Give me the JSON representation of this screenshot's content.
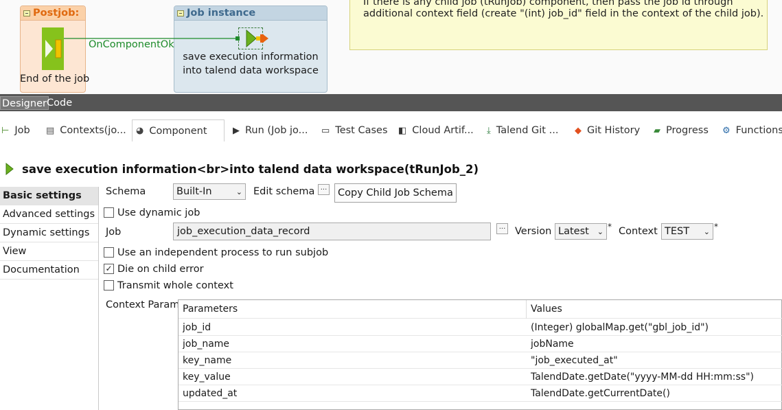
{
  "canvas": {
    "note_lines": [
      "If there is any child job (tRunJob) component, then pass the job id through",
      "additional context field (create \"(int) job_id\" field in the context of the child job)."
    ],
    "postjob_title": "Postjob:",
    "postjob_component_label": "End of the job",
    "link_label": "OnComponentOk",
    "subjob_title": "Job instance",
    "runjob_label_line1": "save execution information",
    "runjob_label_line2": "into talend data workspace"
  },
  "editor_tabs": [
    "Designer",
    "Code"
  ],
  "view_tabs": [
    {
      "label": "Job",
      "icon": "job-icon"
    },
    {
      "label": "Contexts(jo...",
      "icon": "contexts-icon"
    },
    {
      "label": "Component",
      "icon": "component-icon"
    },
    {
      "label": "Run (Job jo...",
      "icon": "run-icon"
    },
    {
      "label": "Test Cases",
      "icon": "test-cases-icon"
    },
    {
      "label": "Cloud Artif...",
      "icon": "cloud-artifact-icon"
    },
    {
      "label": "Talend Git ...",
      "icon": "talend-git-icon"
    },
    {
      "label": "Git History",
      "icon": "git-history-icon"
    },
    {
      "label": "Progress",
      "icon": "progress-icon"
    },
    {
      "label": "Functions",
      "icon": "functions-icon"
    }
  ],
  "component_title": "save execution information<br>into talend data workspace(tRunJob_2)",
  "left_nav": [
    "Basic settings",
    "Advanced settings",
    "Dynamic settings",
    "View",
    "Documentation"
  ],
  "form": {
    "schema_label": "Schema",
    "schema_value": "Built-In",
    "edit_schema_label": "Edit schema",
    "edit_schema_button": "...",
    "copy_schema_button": "Copy Child Job Schema",
    "use_dynamic_job": "Use dynamic job",
    "job_label": "Job",
    "job_value": "job_execution_data_record",
    "job_browse_button": "...",
    "version_label": "Version",
    "version_value": "Latest",
    "required_mark": "*",
    "context_label": "Context",
    "context_value": "TEST",
    "independent_process": "Use an independent process to run subjob",
    "die_on_error": "Die on child error",
    "transmit_context": "Transmit whole context",
    "context_param_label": "Context Param",
    "checkbox_checked_mark": "✓"
  },
  "context_params": {
    "headers": [
      "Parameters",
      "Values"
    ],
    "rows": [
      [
        "job_id",
        "(Integer) globalMap.get(\"gbl_job_id\")"
      ],
      [
        "job_name",
        "jobName"
      ],
      [
        "key_name",
        "\"job_executed_at\""
      ],
      [
        "key_value",
        "TalendDate.getDate(\"yyyy-MM-dd HH:mm:ss\")"
      ],
      [
        "updated_at",
        "TalendDate.getCurrentDate()"
      ]
    ]
  },
  "colors": {
    "postjob_accent": "#e06a10",
    "subjob_accent": "#3f6a8e",
    "link_green": "#1d8b2a",
    "component_green": "#86c21c",
    "connector_orange": "#e8620f"
  }
}
